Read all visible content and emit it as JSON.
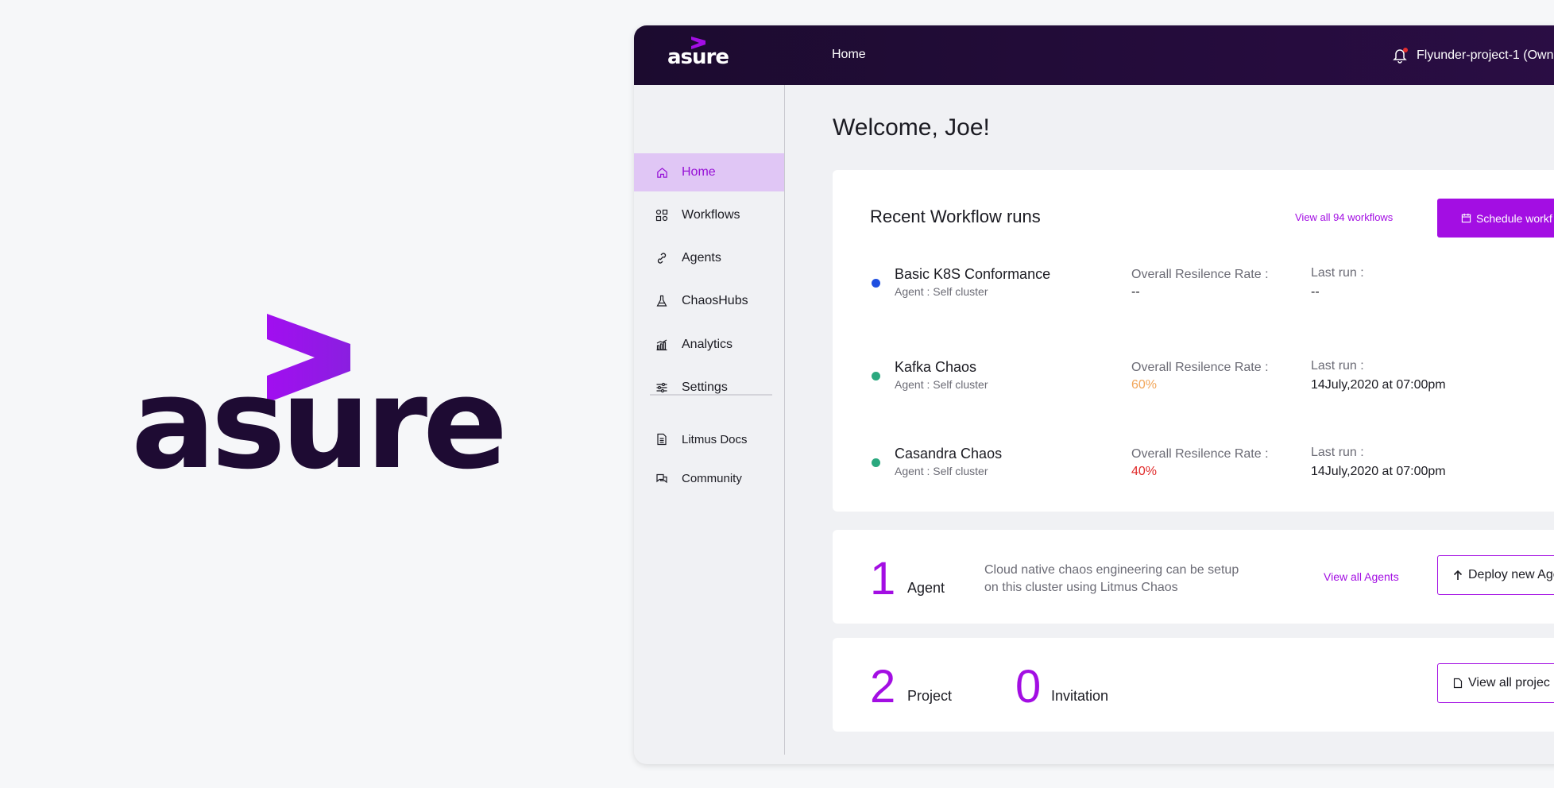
{
  "brand": {
    "name": "asure",
    "primary_color": "#a30ee3",
    "dark_color": "#1e0b33"
  },
  "topbar": {
    "logo_text": "asure",
    "home_link": "Home",
    "notification_icon": "bell-icon",
    "project_selector": "Flyunder-project-1 (Own"
  },
  "sidebar": {
    "items": [
      {
        "label": "Home",
        "icon": "home-icon",
        "active": true
      },
      {
        "label": "Workflows",
        "icon": "grid-icon",
        "active": false
      },
      {
        "label": "Agents",
        "icon": "link-icon",
        "active": false
      },
      {
        "label": "ChaosHubs",
        "icon": "flask-icon",
        "active": false
      },
      {
        "label": "Analytics",
        "icon": "bar-chart-icon",
        "active": false
      },
      {
        "label": "Settings",
        "icon": "sliders-icon",
        "active": false
      }
    ],
    "secondary": [
      {
        "label": "Litmus Docs",
        "icon": "document-icon"
      },
      {
        "label": "Community",
        "icon": "chat-icon"
      }
    ]
  },
  "main": {
    "welcome": "Welcome, Joe!",
    "runs": {
      "title": "Recent Workflow runs",
      "view_all": "View all 94 workflows",
      "schedule_button": "Schedule workf",
      "rows": [
        {
          "name": "Basic K8S Conformance",
          "agent": "Agent : Self cluster",
          "rate_label": "Overall Resilence Rate :",
          "rate": "--",
          "rate_color": "#1b1b22",
          "dot_color": "#1f4fe0",
          "last_run_label": "Last run :",
          "last_run": "--"
        },
        {
          "name": "Kafka Chaos",
          "agent": "Agent : Self cluster",
          "rate_label": "Overall Resilence Rate :",
          "rate": "60%",
          "rate_color": "#f2a65a",
          "dot_color": "#2aa87e",
          "last_run_label": "Last run :",
          "last_run": "14July,2020 at 07:00pm"
        },
        {
          "name": "Casandra Chaos",
          "agent": "Agent : Self cluster",
          "rate_label": "Overall Resilence Rate :",
          "rate": "40%",
          "rate_color": "#e02b2b",
          "dot_color": "#2aa87e",
          "last_run_label": "Last run :",
          "last_run": "14July,2020 at 07:00pm"
        }
      ]
    },
    "agents": {
      "count": "1",
      "label": "Agent",
      "description": "Cloud native chaos engineering can be setup on this cluster using Litmus Chaos",
      "view_all": "View all Agents",
      "deploy_button": "Deploy new Age"
    },
    "projects": {
      "project_count": "2",
      "project_label": "Project",
      "invitation_count": "0",
      "invitation_label": "Invitation",
      "view_all_button": "View all projec"
    }
  }
}
